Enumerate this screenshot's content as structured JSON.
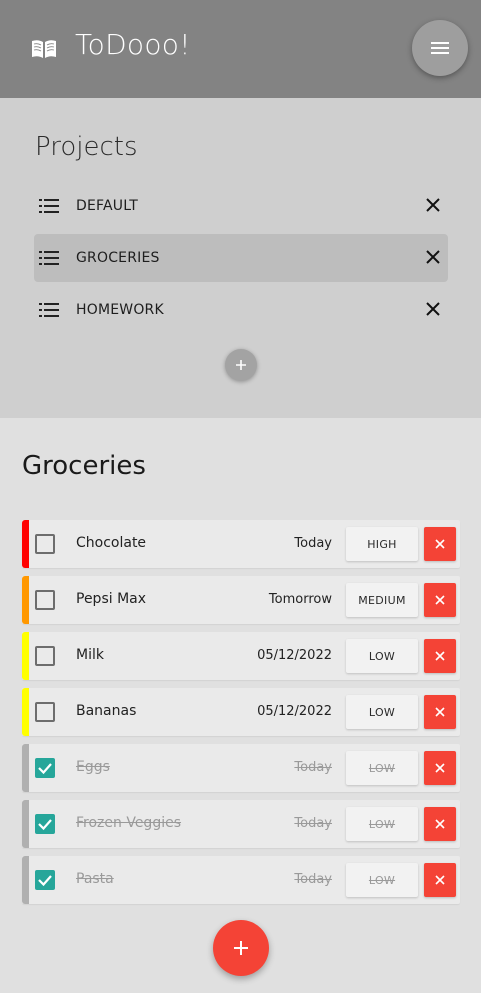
{
  "header": {
    "logo_icon": "book-open-icon",
    "title": "ToDooo!",
    "menu_icon": "hamburger-menu-icon"
  },
  "projects": {
    "title": "Projects",
    "items": [
      {
        "label": "DEFAULT",
        "active": false
      },
      {
        "label": "GROCERIES",
        "active": true
      },
      {
        "label": "HOMEWORK",
        "active": false
      }
    ],
    "add_icon": "plus-icon"
  },
  "list": {
    "title": "Groceries",
    "tasks": [
      {
        "name": "Chocolate",
        "date": "Today",
        "priority": "HIGH",
        "done": false,
        "color": "#ff0000"
      },
      {
        "name": "Pepsi Max",
        "date": "Tomorrow",
        "priority": "MEDIUM",
        "done": false,
        "color": "#ff9800"
      },
      {
        "name": "Milk",
        "date": "05/12/2022",
        "priority": "LOW",
        "done": false,
        "color": "#ffff00"
      },
      {
        "name": "Bananas",
        "date": "05/12/2022",
        "priority": "LOW",
        "done": false,
        "color": "#ffff00"
      },
      {
        "name": "Eggs",
        "date": "Today",
        "priority": "LOW",
        "done": true,
        "color": "#b0b0b0"
      },
      {
        "name": "Frozen Veggies",
        "date": "Today",
        "priority": "LOW",
        "done": true,
        "color": "#b0b0b0"
      },
      {
        "name": "Pasta",
        "date": "Today",
        "priority": "LOW",
        "done": true,
        "color": "#b0b0b0"
      }
    ]
  },
  "colors": {
    "header_bg": "#838383",
    "projects_bg": "#cfcfcf",
    "main_bg": "#e0e0e0",
    "delete_red": "#f44336",
    "check_teal": "#26a69a"
  }
}
